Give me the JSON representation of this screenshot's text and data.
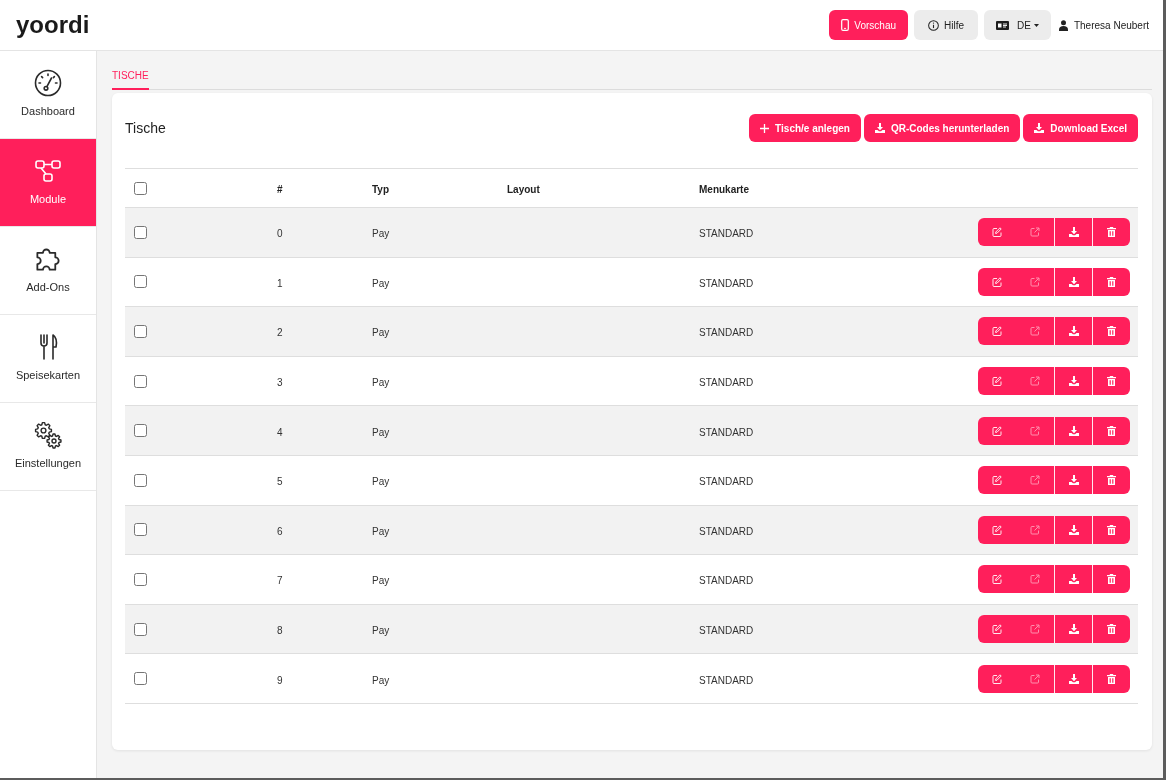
{
  "header": {
    "logo": "yoordi",
    "buttons": [
      {
        "kind": "preview",
        "label": "Vorschau"
      },
      {
        "kind": "help",
        "label": "Hilfe"
      },
      {
        "kind": "language",
        "label": "DE"
      }
    ],
    "user": {
      "name": "Theresa Neubert"
    }
  },
  "sidebar": {
    "items": [
      {
        "kind": "dashboard",
        "label": "Dashboard",
        "selected": false
      },
      {
        "kind": "modules",
        "label": "Module",
        "selected": true
      },
      {
        "kind": "addons",
        "label": "Add-Ons",
        "selected": false
      },
      {
        "kind": "menus",
        "label": "Speisekarten",
        "selected": false
      },
      {
        "kind": "settings",
        "label": "Einstellungen",
        "selected": false
      }
    ]
  },
  "tabs": [
    {
      "label": "TISCHE",
      "selected": true
    }
  ],
  "card": {
    "title": "Tische",
    "actions": [
      {
        "kind": "add",
        "label": "Tisch/e anlegen"
      },
      {
        "kind": "download",
        "label": "QR-Codes herunterladen"
      },
      {
        "kind": "download",
        "label": "Download Excel"
      }
    ]
  },
  "table": {
    "select_all_checked": false,
    "columns": [
      "#",
      "Typ",
      "Layout",
      "Menukarte"
    ],
    "row_actions": [
      {
        "kind": "edit",
        "disabled": false
      },
      {
        "kind": "open",
        "disabled": true
      },
      {
        "kind": "download",
        "disabled": false
      },
      {
        "kind": "delete",
        "disabled": false
      }
    ],
    "rows": [
      {
        "number": "0",
        "type": "Pay",
        "menu": "STANDARD",
        "checked": false
      },
      {
        "number": "1",
        "type": "Pay",
        "menu": "STANDARD",
        "checked": false
      },
      {
        "number": "2",
        "type": "Pay",
        "menu": "STANDARD",
        "checked": false
      },
      {
        "number": "3",
        "type": "Pay",
        "menu": "STANDARD",
        "checked": false
      },
      {
        "number": "4",
        "type": "Pay",
        "menu": "STANDARD",
        "checked": false
      },
      {
        "number": "5",
        "type": "Pay",
        "menu": "STANDARD",
        "checked": false
      },
      {
        "number": "6",
        "type": "Pay",
        "menu": "STANDARD",
        "checked": false
      },
      {
        "number": "7",
        "type": "Pay",
        "menu": "STANDARD",
        "checked": false
      },
      {
        "number": "8",
        "type": "Pay",
        "menu": "STANDARD",
        "checked": false
      },
      {
        "number": "9",
        "type": "Pay",
        "menu": "STANDARD",
        "checked": false
      }
    ]
  }
}
